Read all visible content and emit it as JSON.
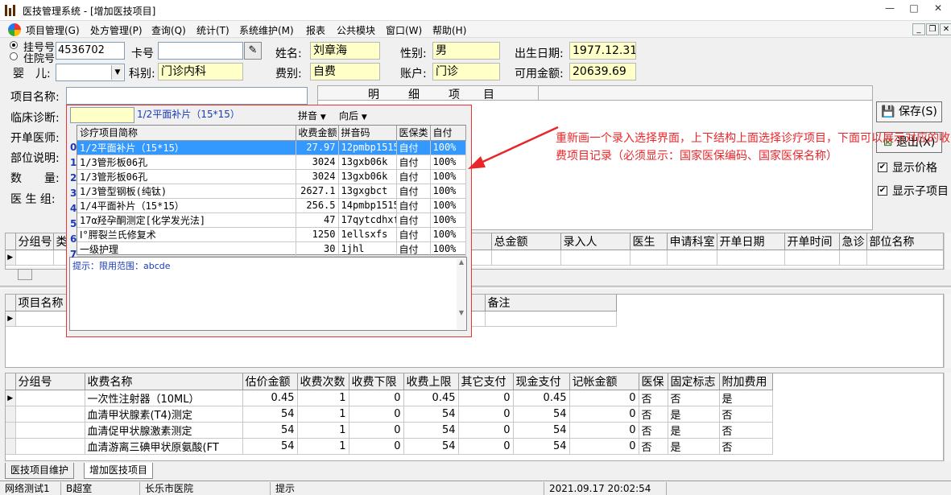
{
  "window": {
    "title": "医技管理系统 - [增加医技项目]",
    "min": "—",
    "max": "□",
    "close": "✕"
  },
  "menu": [
    "项目管理(G)",
    "处方管理(P)",
    "查询(Q)",
    "统计(T)",
    "系统维护(M)",
    "报表",
    "公共模块",
    "窗口(W)",
    "帮助(H)"
  ],
  "mdi": {
    "min": "_",
    "restore": "❐",
    "close": "✕"
  },
  "patient": {
    "radio1": "挂号号",
    "radio2": "住院号",
    "reg_no": "4536702",
    "card_label": "卡号",
    "card_no": "",
    "name_label": "姓名:",
    "name": "刘章海",
    "sex_label": "性别:",
    "sex": "男",
    "dob_label": "出生日期:",
    "dob": "1977.12.31",
    "baby_label": "婴　儿:",
    "baby": "",
    "dept_label": "科别:",
    "dept": "门诊内科",
    "fee_label": "费别:",
    "fee_type": "自费",
    "account_label": "账户:",
    "account": "门诊",
    "balance_label": "可用金额:",
    "balance": "20639.69"
  },
  "form": {
    "item_name": "项目名称:",
    "diag": "临床诊断:",
    "doctor": "开单医师:",
    "part": "部位说明:",
    "qty": "数　　量:",
    "group": "医 生 组:"
  },
  "detail_header": [
    "明",
    "细",
    "项",
    "目"
  ],
  "popup": {
    "input": "",
    "current": "1/2平面补片（15*15）",
    "mode": "拼音",
    "direction": "向后",
    "columns": [
      "诊疗项目简称",
      "收费金额",
      "拼音码",
      "医保类",
      "自付"
    ],
    "rows": [
      {
        "no": "0",
        "name": "1/2平面补片（15*15）",
        "amount": "27.97",
        "code": "12pmbp1515",
        "ins": "自付",
        "self": "100%"
      },
      {
        "no": "1",
        "name": "1/3管形板06孔",
        "amount": "3024",
        "code": "13gxb06k",
        "ins": "自付",
        "self": "100%"
      },
      {
        "no": "2",
        "name": "1/3管形板06孔",
        "amount": "3024",
        "code": "13gxb06k",
        "ins": "自付",
        "self": "100%"
      },
      {
        "no": "3",
        "name": "1/3管型钢板(纯钛)",
        "amount": "2627.1",
        "code": "13gxgbct",
        "ins": "自付",
        "self": "100%"
      },
      {
        "no": "4",
        "name": "1/4平面补片（15*15）",
        "amount": "256.5",
        "code": "14pmbp1515",
        "ins": "自付",
        "self": "100%"
      },
      {
        "no": "5",
        "name": "17α羟孕酮测定[化学发光法]",
        "amount": "47",
        "code": "17qytcdhxf",
        "ins": "自付",
        "self": "100%"
      },
      {
        "no": "6",
        "name": "Ⅰ°腭裂兰氏修复术",
        "amount": "1250",
        "code": "1ellsxfs",
        "ins": "自付",
        "self": "100%"
      },
      {
        "no": "7",
        "name": "一级护理",
        "amount": "30",
        "code": "1jhl",
        "ins": "自付",
        "self": "100%"
      }
    ],
    "hint": "提示：限用范围：abcde"
  },
  "annotation": "重新画一个录入选择界面，上下结构上面选择诊疗项目，下面可以展示对应的收费项目记录（必须显示：国家医保编码、国家医保名称）",
  "buttons": {
    "save": "保存(S)",
    "exit": "退出(X)"
  },
  "checks": [
    {
      "label": "显示价格",
      "checked": "✔"
    },
    {
      "label": "显示子项目",
      "checked": "✔"
    }
  ],
  "grid1": {
    "columns": [
      "分组号",
      "类",
      "总金额",
      "录入人",
      "医生",
      "申请科室",
      "开单日期",
      "开单时间",
      "急诊",
      "部位名称"
    ]
  },
  "grid2": {
    "columns": [
      "项目名称",
      "备注"
    ]
  },
  "grid3": {
    "columns": [
      "分组号",
      "收费名称",
      "估价金额",
      "收费次数",
      "收费下限",
      "收费上限",
      "其它支付",
      "现金支付",
      "记帐金额",
      "医保",
      "固定标志",
      "附加费用"
    ],
    "rows": [
      [
        "",
        "一次性注射器（10ML）",
        "0.45",
        "1",
        "0",
        "0.45",
        "0",
        "0.45",
        "0",
        "否",
        "否",
        "是"
      ],
      [
        "",
        "血清甲状腺素(T4)测定",
        "54",
        "1",
        "0",
        "54",
        "0",
        "54",
        "0",
        "否",
        "是",
        "否"
      ],
      [
        "",
        "血清促甲状腺激素测定",
        "54",
        "1",
        "0",
        "54",
        "0",
        "54",
        "0",
        "否",
        "是",
        "否"
      ],
      [
        "",
        "血清游离三碘甲状原氨酸(FT",
        "54",
        "1",
        "0",
        "54",
        "0",
        "54",
        "0",
        "否",
        "是",
        "否"
      ]
    ]
  },
  "tabs": [
    "医技项目维护",
    "增加医技项目"
  ],
  "status": [
    "网络测试1",
    "B超室",
    "长乐市医院",
    "提示",
    "2021.09.17 20:02:54"
  ]
}
